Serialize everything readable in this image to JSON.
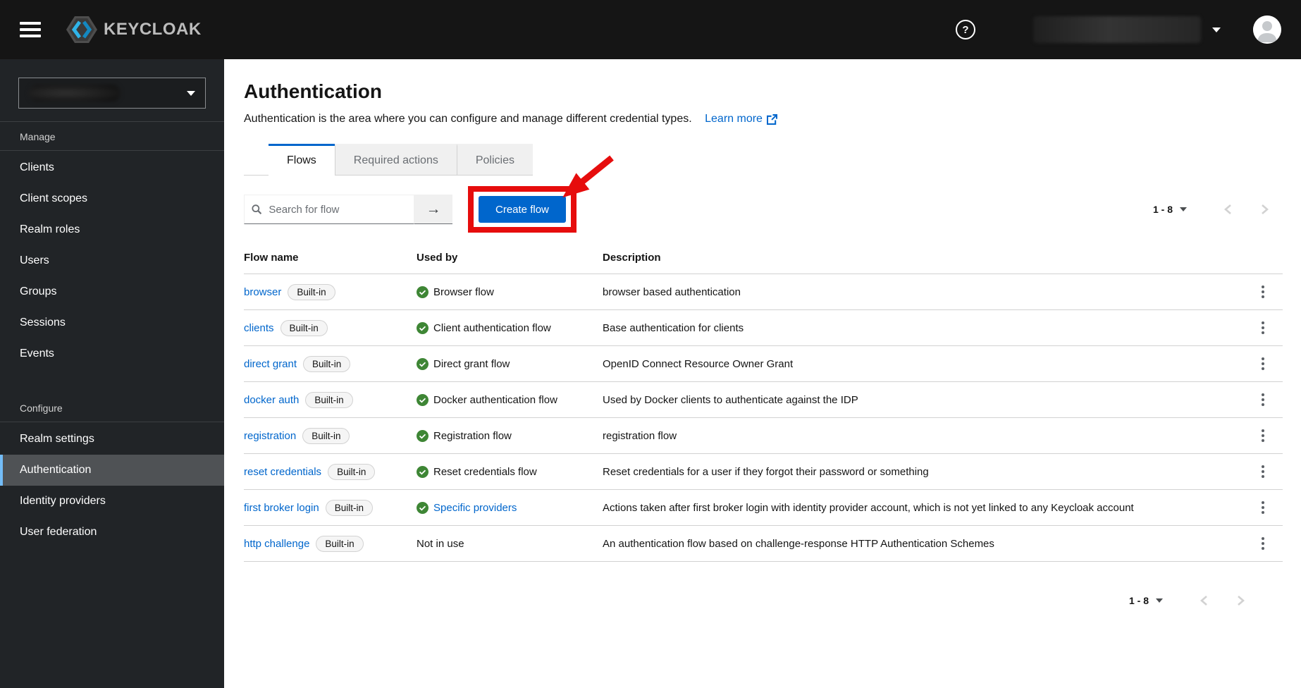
{
  "header": {
    "brand": "KEYCLOAK"
  },
  "sidebar": {
    "sections": [
      {
        "label": "Manage",
        "items": [
          {
            "label": "Clients"
          },
          {
            "label": "Client scopes"
          },
          {
            "label": "Realm roles"
          },
          {
            "label": "Users"
          },
          {
            "label": "Groups"
          },
          {
            "label": "Sessions"
          },
          {
            "label": "Events"
          }
        ]
      },
      {
        "label": "Configure",
        "items": [
          {
            "label": "Realm settings"
          },
          {
            "label": "Authentication",
            "selected": true
          },
          {
            "label": "Identity providers"
          },
          {
            "label": "User federation"
          }
        ]
      }
    ]
  },
  "page": {
    "title": "Authentication",
    "description": "Authentication is the area where you can configure and manage different credential types.",
    "learn_more": "Learn more"
  },
  "tabs": [
    {
      "label": "Flows",
      "active": true
    },
    {
      "label": "Required actions",
      "active": false
    },
    {
      "label": "Policies",
      "active": false
    }
  ],
  "toolbar": {
    "search_placeholder": "Search for flow",
    "search_submit_icon": "→",
    "create_flow_label": "Create flow"
  },
  "pagination": {
    "range": "1 - 8"
  },
  "table": {
    "columns": [
      "Flow name",
      "Used by",
      "Description"
    ],
    "rows": [
      {
        "name": "browser",
        "badge": "Built-in",
        "used_by": "Browser flow",
        "used_by_style": "check",
        "description": "browser based authentication"
      },
      {
        "name": "clients",
        "badge": "Built-in",
        "used_by": "Client authentication flow",
        "used_by_style": "check",
        "description": "Base authentication for clients"
      },
      {
        "name": "direct grant",
        "badge": "Built-in",
        "used_by": "Direct grant flow",
        "used_by_style": "check",
        "description": "OpenID Connect Resource Owner Grant"
      },
      {
        "name": "docker auth",
        "badge": "Built-in",
        "used_by": "Docker authentication flow",
        "used_by_style": "check",
        "description": "Used by Docker clients to authenticate against the IDP"
      },
      {
        "name": "registration",
        "badge": "Built-in",
        "used_by": "Registration flow",
        "used_by_style": "check",
        "description": "registration flow"
      },
      {
        "name": "reset credentials",
        "badge": "Built-in",
        "used_by": "Reset credentials flow",
        "used_by_style": "check",
        "description": "Reset credentials for a user if they forgot their password or something"
      },
      {
        "name": "first broker login",
        "badge": "Built-in",
        "used_by": "Specific providers",
        "used_by_style": "check-link",
        "description": "Actions taken after first broker login with identity provider account, which is not yet linked to any Keycloak account"
      },
      {
        "name": "http challenge",
        "badge": "Built-in",
        "used_by": "Not in use",
        "used_by_style": "none",
        "description": "An authentication flow based on challenge-response HTTP Authentication Schemes"
      }
    ]
  },
  "colors": {
    "accent_blue": "#0066cc",
    "link_blue": "#0066cc",
    "success_green": "#3e8635",
    "annotation_red": "#e60d0d",
    "sidebar_accent": "#73bcf7"
  }
}
